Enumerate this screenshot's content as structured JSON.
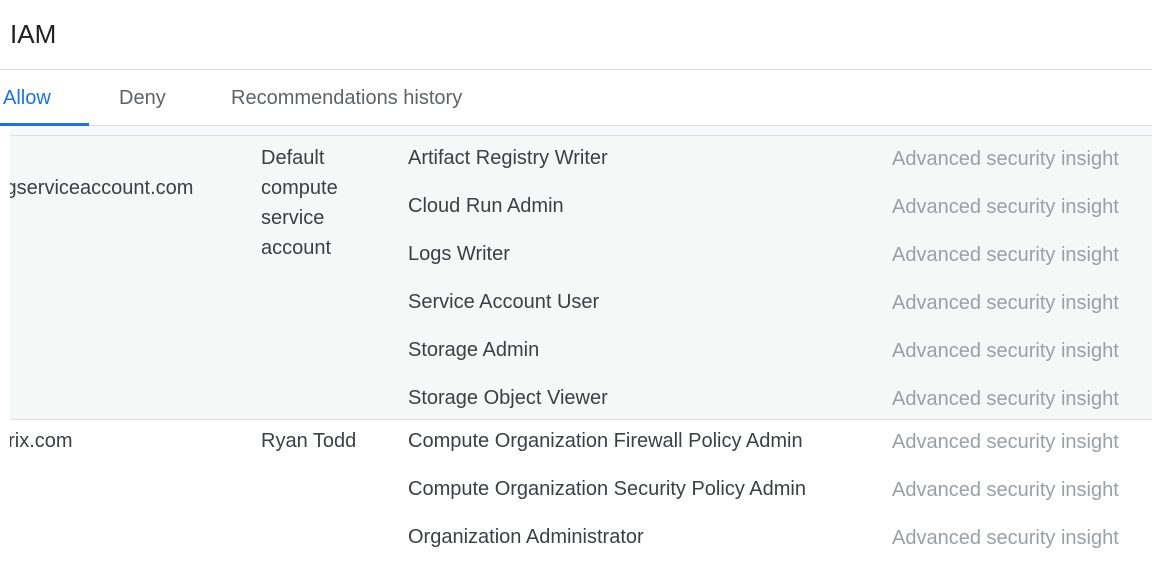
{
  "header": {
    "title": "IAM"
  },
  "tabs": [
    {
      "label": "Allow",
      "active": true
    },
    {
      "label": "Deny",
      "active": false
    },
    {
      "label": "Recommendations history",
      "active": false
    }
  ],
  "groups": [
    {
      "principal": ".gserviceaccount.com",
      "name": "Default compute service account",
      "roles": [
        {
          "role": "Artifact Registry Writer",
          "insight": "Advanced security insight"
        },
        {
          "role": "Cloud Run Admin",
          "insight": "Advanced security insight"
        },
        {
          "role": "Logs Writer",
          "insight": "Advanced security insight"
        },
        {
          "role": "Service Account User",
          "insight": "Advanced security insight"
        },
        {
          "role": "Storage Admin",
          "insight": "Advanced security insight"
        },
        {
          "role": "Storage Object Viewer",
          "insight": "Advanced security insight"
        }
      ]
    },
    {
      "principal": "orix.com",
      "name": "Ryan Todd",
      "roles": [
        {
          "role": "Compute Organization Firewall Policy Admin",
          "insight": "Advanced security insight"
        },
        {
          "role": "Compute Organization Security Policy Admin",
          "insight": "Advanced security insight"
        },
        {
          "role": "Organization Administrator",
          "insight": "Advanced security insight"
        }
      ]
    }
  ],
  "colors": {
    "accent": "#1a73e8",
    "muted_text": "#9aa0a6",
    "selected_row_bg": "#f6f7f7"
  }
}
